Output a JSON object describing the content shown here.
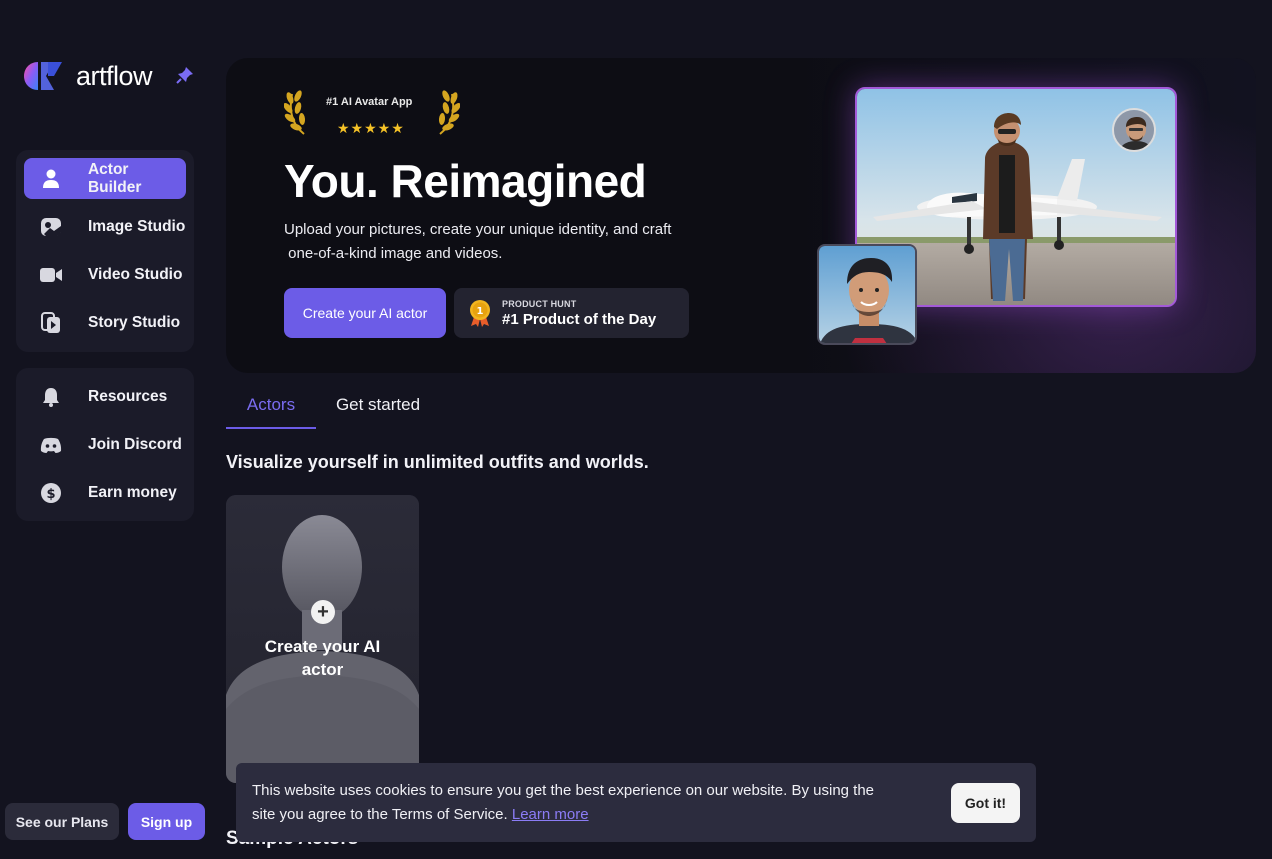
{
  "brand": {
    "name": "artflow"
  },
  "sidebar": {
    "primary": [
      {
        "label": "Actor Builder",
        "icon": "user-icon",
        "active": true
      },
      {
        "label": "Image Studio",
        "icon": "image-icon",
        "active": false
      },
      {
        "label": "Video Studio",
        "icon": "video-camera-icon",
        "active": false
      },
      {
        "label": "Story Studio",
        "icon": "story-icon",
        "active": false
      }
    ],
    "secondary": [
      {
        "label": "Resources",
        "icon": "bell-icon"
      },
      {
        "label": "Join Discord",
        "icon": "discord-icon"
      },
      {
        "label": "Earn money",
        "icon": "dollar-icon"
      }
    ],
    "plans_label": "See our Plans",
    "signup_label": "Sign up"
  },
  "hero": {
    "award_title": "#1 AI Avatar App",
    "award_stars": "★★★★★",
    "title": "You. Reimagined",
    "subtitle_line1": "Upload your pictures, create your unique identity, and craft",
    "subtitle_line2": " one-of-a-kind image and videos.",
    "cta_label": "Create your AI actor",
    "product_hunt_small": "PRODUCT HUNT",
    "product_hunt_big": "#1 Product of the Day",
    "medal_number": "1"
  },
  "tabs": [
    {
      "label": "Actors",
      "active": true
    },
    {
      "label": "Get started",
      "active": false
    }
  ],
  "main": {
    "section_title": "Visualize yourself in unlimited outfits and worlds.",
    "actor_card_label": "Create your AI actor",
    "sample_title": "Sample Actors"
  },
  "cookie": {
    "text": "This website uses cookies to ensure you get the best experience on our website. By using the site you agree to the Terms of Service. ",
    "link": "Learn more",
    "button": "Got it!"
  },
  "colors": {
    "accent": "#6c5ce7",
    "background": "#13131f",
    "card": "#1b1b29"
  }
}
